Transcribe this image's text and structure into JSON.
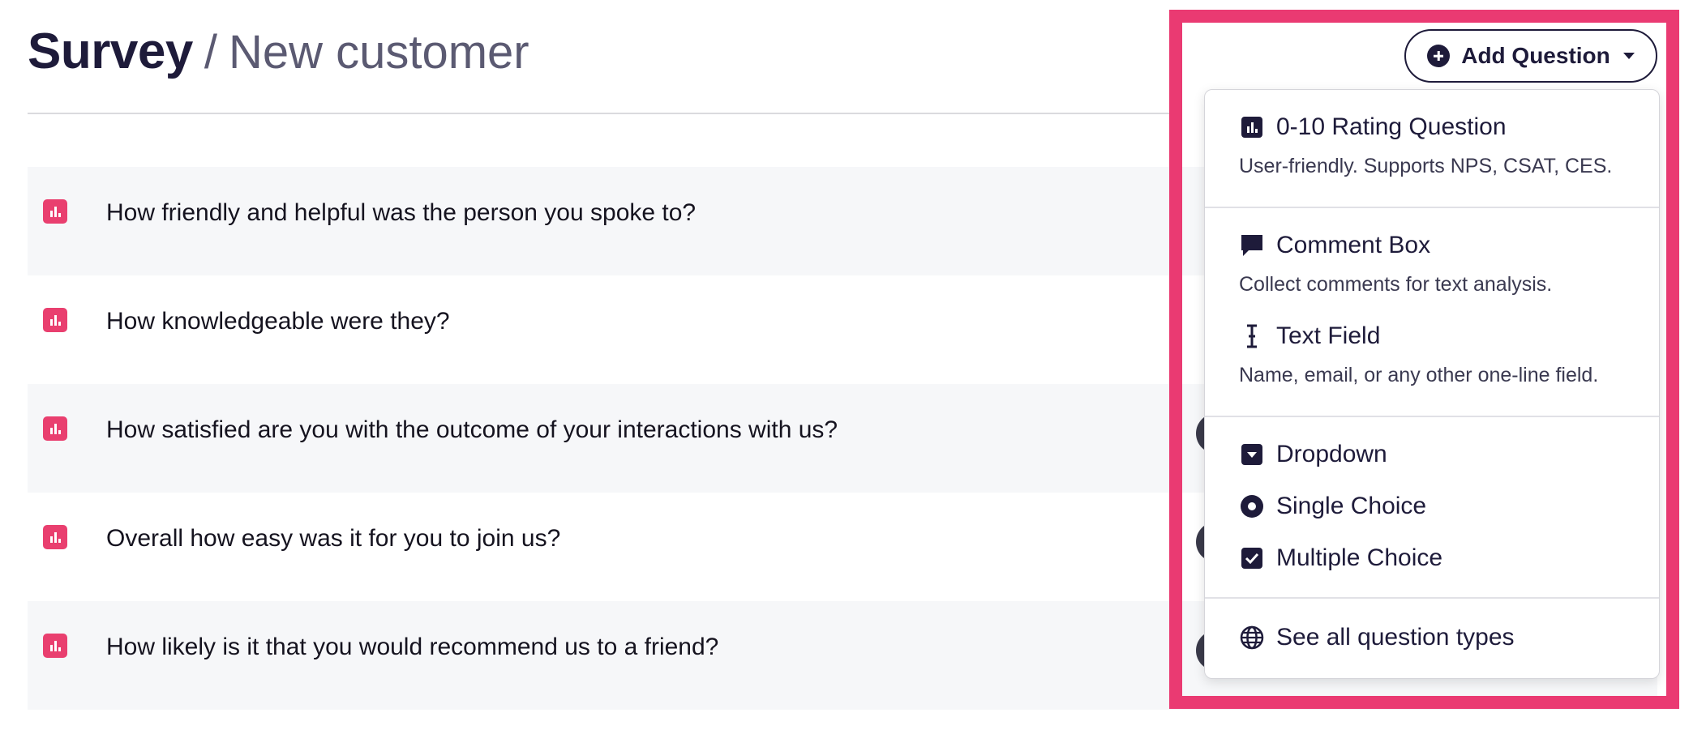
{
  "header": {
    "title": "Survey",
    "separator": "/",
    "subtitle": "New customer"
  },
  "questions": [
    {
      "text": "How friendly and helpful was the person you spoke to?"
    },
    {
      "text": "How knowledgeable were they?"
    },
    {
      "text": "How satisfied are you with the outcome of your interactions with us?"
    },
    {
      "text": "Overall how easy was it for you to join us?"
    },
    {
      "text": "How likely is it that you would recommend us to a friend?"
    }
  ],
  "add_button": {
    "label": "Add Question",
    "icon": "plus-circle-icon"
  },
  "menu": {
    "sections": [
      {
        "items": [
          {
            "label": "0-10 Rating Question",
            "description": "User-friendly. Supports NPS, CSAT, CES.",
            "icon": "bar-chart-icon"
          }
        ]
      },
      {
        "items": [
          {
            "label": "Comment Box",
            "description": "Collect comments for text analysis.",
            "icon": "comment-icon"
          },
          {
            "label": "Text Field",
            "description": "Name, email, or any other one-line field.",
            "icon": "text-cursor-icon"
          }
        ]
      },
      {
        "items": [
          {
            "label": "Dropdown",
            "icon": "dropdown-icon"
          },
          {
            "label": "Single Choice",
            "icon": "radio-icon"
          },
          {
            "label": "Multiple Choice",
            "icon": "checkbox-icon"
          }
        ]
      },
      {
        "items": [
          {
            "label": "See all question types",
            "icon": "globe-icon"
          }
        ]
      }
    ]
  },
  "colors": {
    "accent": "#e93f6f",
    "highlight_border": "#ea3a72",
    "text_dark": "#1e1b3a",
    "row_shade": "#f6f7f9"
  }
}
